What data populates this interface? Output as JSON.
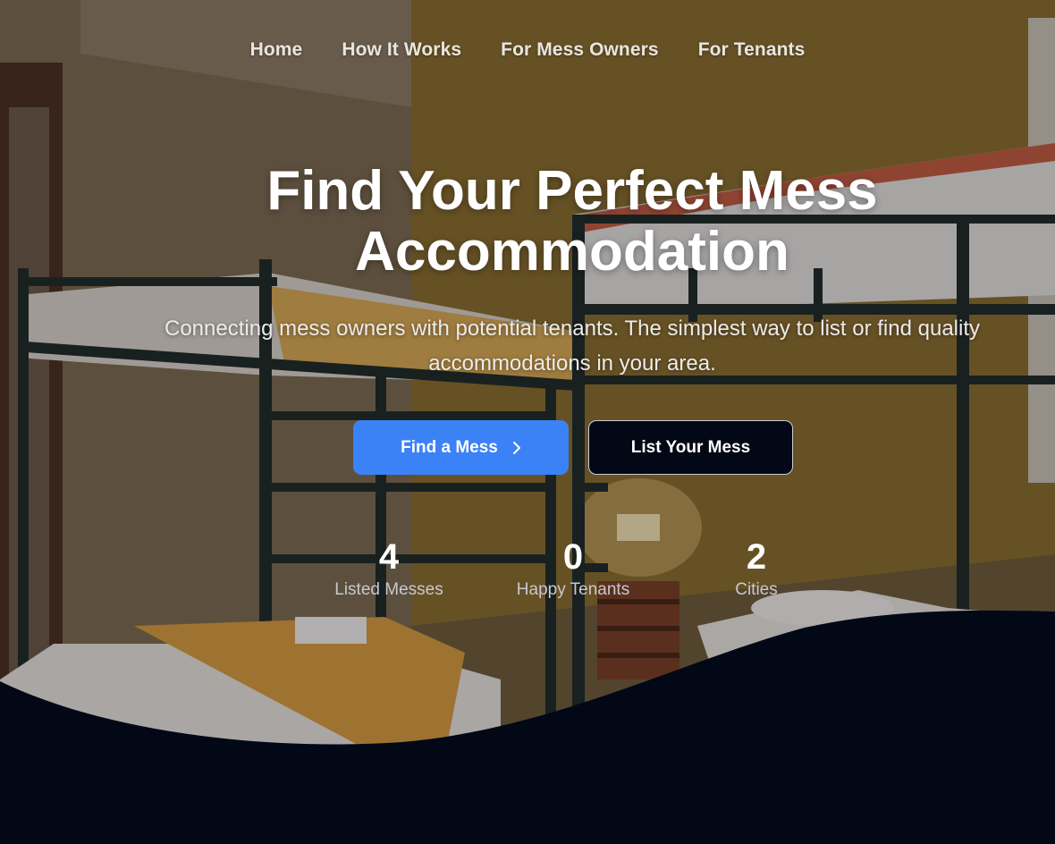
{
  "nav": {
    "items": [
      {
        "label": "Home"
      },
      {
        "label": "How It Works"
      },
      {
        "label": "For Mess Owners"
      },
      {
        "label": "For Tenants"
      }
    ]
  },
  "hero": {
    "title_line1": "Find Your Perfect Mess",
    "title_line2": "Accommodation",
    "subtitle": "Connecting mess owners with potential tenants. The simplest way to list or find quality accommodations in your area.",
    "primary_button": "Find a Mess",
    "secondary_button": "List Your Mess"
  },
  "stats": [
    {
      "value": "4",
      "label": "Listed Messes"
    },
    {
      "value": "0",
      "label": "Happy Tenants"
    },
    {
      "value": "2",
      "label": "Cities"
    }
  ],
  "colors": {
    "accent": "#3b82f6",
    "background_dark": "#030816",
    "text_light": "#ffffff"
  },
  "icons": {
    "primary_button_icon": "chevron-right-icon",
    "hero_image": "bunk-bed-room-photo"
  }
}
